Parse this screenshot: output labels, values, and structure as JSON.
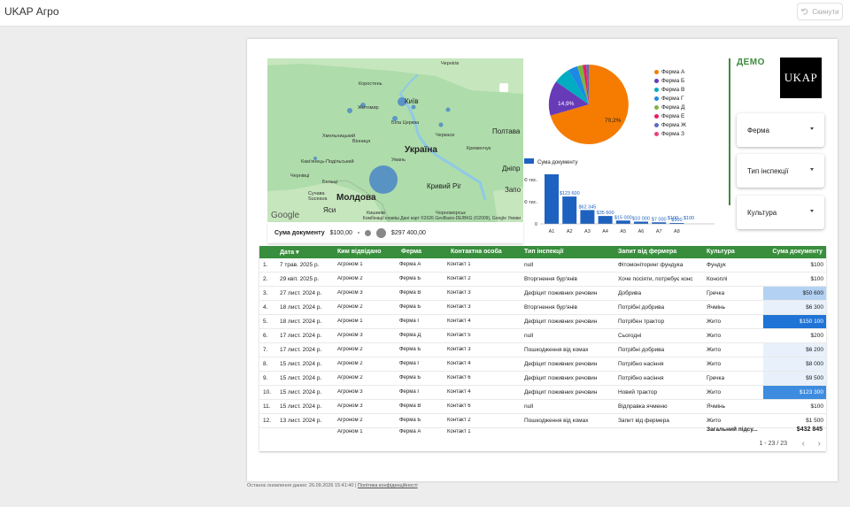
{
  "app": {
    "title": "UKAP Агро",
    "reset_label": "Скинути"
  },
  "map": {
    "cities": [
      {
        "name": "Чернігів",
        "cls": ""
      },
      {
        "name": "Коростень",
        "cls": ""
      },
      {
        "name": "Житомир",
        "cls": ""
      },
      {
        "name": "Київ",
        "cls": "mid"
      },
      {
        "name": "Біла Церква",
        "cls": ""
      },
      {
        "name": "Черкаси",
        "cls": ""
      },
      {
        "name": "Хмельницький",
        "cls": ""
      },
      {
        "name": "Вінниця",
        "cls": ""
      },
      {
        "name": "Україна",
        "cls": "big"
      },
      {
        "name": "Полтава",
        "cls": "mid"
      },
      {
        "name": "Кременчук",
        "cls": ""
      },
      {
        "name": "Умань",
        "cls": ""
      },
      {
        "name": "Кам'янець-Подільський",
        "cls": ""
      },
      {
        "name": "Дніпр",
        "cls": "mid"
      },
      {
        "name": "Молдова",
        "cls": "big"
      },
      {
        "name": "Кривий Ріг",
        "cls": "mid"
      },
      {
        "name": "Запо",
        "cls": "mid"
      },
      {
        "name": "Кишинів",
        "cls": ""
      },
      {
        "name": "Бельці",
        "cls": ""
      },
      {
        "name": "Чернівці",
        "cls": ""
      },
      {
        "name": "Яси",
        "cls": "mid"
      },
      {
        "name": "Suceava",
        "cls": ""
      },
      {
        "name": "Сучава",
        "cls": ""
      },
      {
        "name": "Чорноморськ",
        "cls": ""
      }
    ],
    "google_label": "Google",
    "attribution_1": "Комбінації клавіш",
    "attribution_2": "Дані карт ©2026 GeoBasis-DE/BKG (©2009), Google",
    "attribution_3": "Умови",
    "legend": {
      "title": "Сума документу",
      "min": "$100,00",
      "max": "$297 400,00"
    },
    "colors": {
      "land": "#aedcab",
      "water": "#8fc9e6",
      "bubble": "#4a86c8"
    }
  },
  "pie": {
    "labels": [
      "70,2%",
      "14,9%"
    ],
    "legend": [
      {
        "name": "Ферма А",
        "color": "#f57c00"
      },
      {
        "name": "Ферма Б",
        "color": "#673ab7"
      },
      {
        "name": "Ферма В",
        "color": "#00acc1"
      },
      {
        "name": "Ферма Г",
        "color": "#1e88e5"
      },
      {
        "name": "Ферма Д",
        "color": "#7cb342"
      },
      {
        "name": "Ферма Е",
        "color": "#e91e63"
      },
      {
        "name": "Ферма Ж",
        "color": "#5c6bc0"
      },
      {
        "name": "Ферма З",
        "color": "#ec407a"
      }
    ]
  },
  "chart_data": {
    "type": "bar",
    "series_name": "Сума документу",
    "categories": [
      "А1",
      "А2",
      "А3",
      "А4",
      "А5",
      "А6",
      "А7",
      "А8"
    ],
    "values": [
      297400,
      123600,
      62345,
      35600,
      15000,
      10000,
      7000,
      100
    ],
    "data_labels": [
      "",
      "$123 600",
      "$62 345",
      "$35 600",
      "$15 000",
      "$10 000",
      "$7 000",
      "$100"
    ],
    "y_ticks": [
      "0",
      "100 тис.",
      "200 тис."
    ],
    "ylim": [
      0,
      200000
    ],
    "extra_labels": [
      "$100",
      "$100"
    ],
    "bar_color": "#1e62c0"
  },
  "demo_label": "ДЕМО",
  "logo_text": "UKAP",
  "filters": [
    "Ферма",
    "Тип інспекції",
    "Культура"
  ],
  "table": {
    "headers": [
      "Дата",
      "Ким відвідано",
      "Ферма",
      "Контактна особа",
      "Тип інспекції",
      "Запит від фермера",
      "Культура",
      "Сума документу"
    ],
    "rows": [
      {
        "n": "1.",
        "date": "7 трав. 2025 р.",
        "who": "Агроном 1",
        "farm": "Ферма А",
        "cont": "Контакт 1",
        "type": "null",
        "req": "Фітомоніторинг фундука",
        "crop": "Фундук",
        "sum": "$100",
        "bg": ""
      },
      {
        "n": "2.",
        "date": "29 квіт. 2025 р.",
        "who": "Агроном 2",
        "farm": "Ферма Б",
        "cont": "Контакт 2",
        "type": "Вторгнення бур'янів",
        "req": "Хоче посіяти, потребує конс",
        "crop": "Коноплі",
        "sum": "$100",
        "bg": ""
      },
      {
        "n": "3.",
        "date": "27 лист. 2024 р.",
        "who": "Агроном 3",
        "farm": "Ферма В",
        "cont": "Контакт 3",
        "type": "Дефіцит поживних речовин",
        "req": "Добрива",
        "crop": "Гречка",
        "sum": "$50 600",
        "bg": "#b3d2f3"
      },
      {
        "n": "4.",
        "date": "18 лист. 2024 р.",
        "who": "Агроном 2",
        "farm": "Ферма Б",
        "cont": "Контакт 3",
        "type": "Вторгнення бур'янів",
        "req": "Потрібні добрива",
        "crop": "Ячмінь",
        "sum": "$6 300",
        "bg": "#e8f1fb"
      },
      {
        "n": "5.",
        "date": "18 лист. 2024 р.",
        "who": "Агроном 1",
        "farm": "Ферма Г",
        "cont": "Контакт 4",
        "type": "Дефіцит поживних речовин",
        "req": "Потрібен трактор",
        "crop": "Жито",
        "sum": "$150 100",
        "bg": "#1f74d6"
      },
      {
        "n": "6.",
        "date": "17 лист. 2024 р.",
        "who": "Агроном 3",
        "farm": "Ферма Д",
        "cont": "Контакт 5",
        "type": "null",
        "req": "Сьогодні",
        "crop": "Жито",
        "sum": "$200",
        "bg": ""
      },
      {
        "n": "7.",
        "date": "17 лист. 2024 р.",
        "who": "Агроном 2",
        "farm": "Ферма Б",
        "cont": "Контакт 3",
        "type": "Пошкодження від комах",
        "req": "Потрібні добрива",
        "crop": "Жито",
        "sum": "$6 200",
        "bg": "#e8f1fb"
      },
      {
        "n": "8.",
        "date": "15 лист. 2024 р.",
        "who": "Агроном 2",
        "farm": "Ферма Г",
        "cont": "Контакт 4",
        "type": "Дефіцит поживних речовин",
        "req": "Потрібно насіння",
        "crop": "Жито",
        "sum": "$8 000",
        "bg": "#e8f1fb"
      },
      {
        "n": "9.",
        "date": "15 лист. 2024 р.",
        "who": "Агроном 2",
        "farm": "Ферма Б",
        "cont": "Контакт 6",
        "type": "Дефіцит поживних речовин",
        "req": "Потрібно насіння",
        "crop": "Гречка",
        "sum": "$9 500",
        "bg": "#e8f1fb"
      },
      {
        "n": "10.",
        "date": "15 лист. 2024 р.",
        "who": "Агроном 3",
        "farm": "Ферма Г",
        "cont": "Контакт 4",
        "type": "Дефіцит поживних речовин",
        "req": "Новий трактор",
        "crop": "Жито",
        "sum": "$123 300",
        "bg": "#3d8ce0"
      },
      {
        "n": "11.",
        "date": "15 лист. 2024 р.",
        "who": "Агроном 3",
        "farm": "Ферма В",
        "cont": "Контакт 6",
        "type": "null",
        "req": "Відправка ячменю",
        "crop": "Ячмінь",
        "sum": "$100",
        "bg": ""
      },
      {
        "n": "12.",
        "date": "13 лист. 2024 р.",
        "who": "Агроном 2",
        "farm": "Ферма Б",
        "cont": "Контакт 2",
        "type": "Пошкодження від комах",
        "req": "Запит від фермера",
        "crop": "Жито",
        "sum": "$1 500",
        "bg": ""
      }
    ],
    "extra_row": {
      "who": "Агроном 1",
      "farm": "Ферма А",
      "cont": "Контакт 1"
    },
    "total_label": "Загальний підсу...",
    "total_value": "$432 845",
    "pager": "1 - 23 / 23"
  },
  "footer": {
    "updated": "Останнє оновлення даних: 26.09.2026 15:41:40",
    "sep": "|",
    "privacy": "Політика конфіденційності"
  }
}
